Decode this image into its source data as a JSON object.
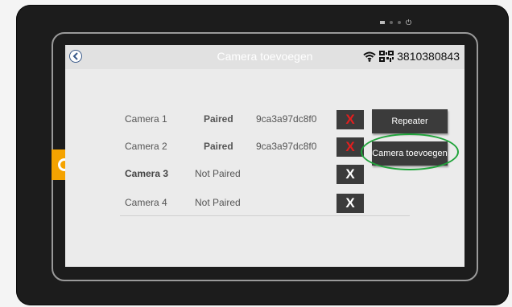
{
  "header": {
    "title": "Camera toevoegen",
    "device_number": "3810380843"
  },
  "cameras": [
    {
      "name": "Camera 1",
      "status": "Paired",
      "id": "9ca3a97dc8f0",
      "delete_label": "X"
    },
    {
      "name": "Camera 2",
      "status": "Paired",
      "id": "9ca3a97dc8f0",
      "delete_label": "X"
    },
    {
      "name": "Camera 3",
      "status": "Not Paired",
      "id": "",
      "delete_label": "X"
    },
    {
      "name": "Camera 4",
      "status": "Not Paired",
      "id": "",
      "delete_label": "X"
    }
  ],
  "buttons": {
    "repeater": "Repeater",
    "add_camera": "Camera toevoegen"
  },
  "icons": {
    "back": "chevron-left-icon",
    "wifi": "wifi-icon",
    "qr": "qr-code-icon",
    "power": "power-icon"
  },
  "colors": {
    "highlight": "#1fa33a",
    "delete_active": "#e31e1e",
    "button_bg": "#3b3b3b",
    "accent_tab": "#f5a300"
  }
}
